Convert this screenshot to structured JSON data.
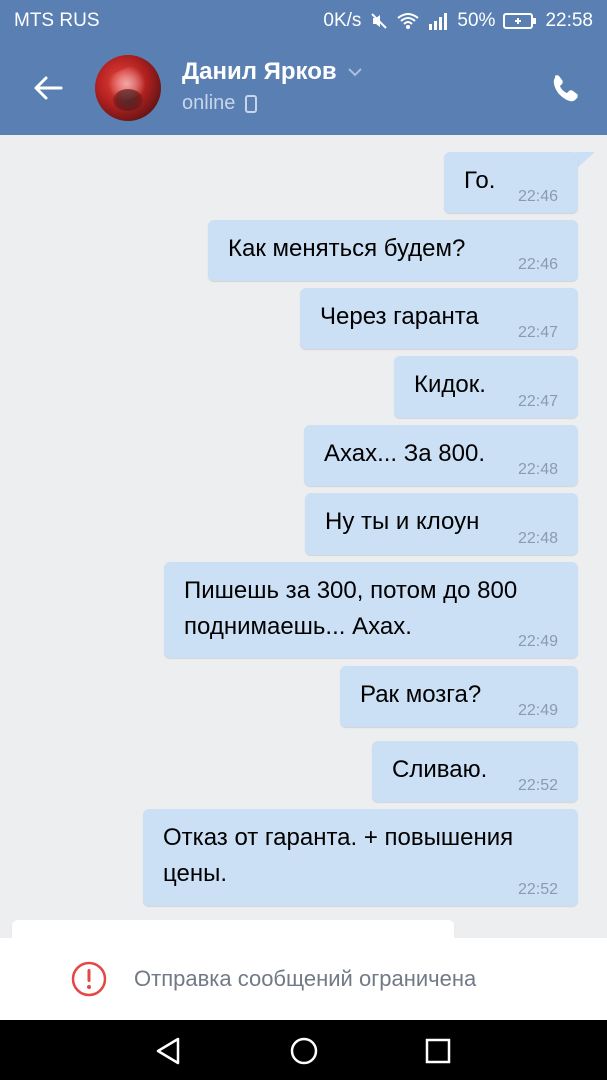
{
  "status_bar": {
    "carrier": "MTS RUS",
    "speed": "0K/s",
    "battery": "50%",
    "time": "22:58"
  },
  "header": {
    "contact_name": "Данил Ярков",
    "status": "online"
  },
  "messages": [
    {
      "text": "Го.",
      "time": "22:46"
    },
    {
      "text": "Как меняться будем?",
      "time": "22:46"
    },
    {
      "text": "Через гаранта",
      "time": "22:47"
    },
    {
      "text": "Кидок.",
      "time": "22:47"
    },
    {
      "text": "Ахах... За 800.",
      "time": "22:48"
    },
    {
      "text": "Ну ты и клоун",
      "time": "22:48"
    },
    {
      "text": "Пишешь за 300, потом до 800\nподнимаешь... Ахах.",
      "time": "22:49"
    },
    {
      "text": "Рак мозга?",
      "time": "22:49"
    },
    {
      "text": "Сливаю.",
      "time": "22:52"
    },
    {
      "text": "Отказ от гаранта. + повышения\nцены.",
      "time": "22:52"
    }
  ],
  "footer": {
    "restriction_text": "Отправка сообщений ограничена"
  },
  "colors": {
    "header_bg": "#5a7fb3",
    "bubble_out": "#cce0f5",
    "chat_bg": "#edeef0",
    "warning_red": "#e64646"
  }
}
